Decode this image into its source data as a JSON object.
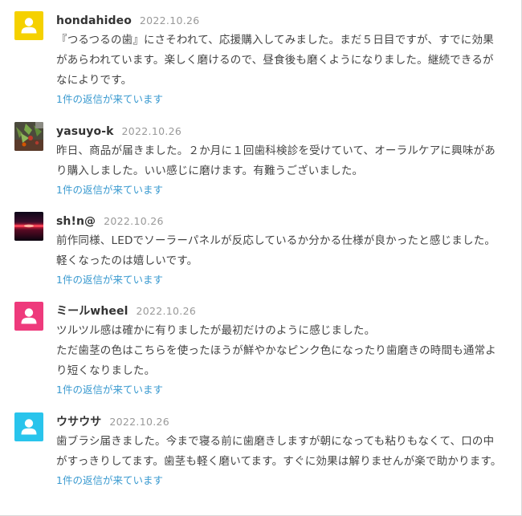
{
  "comments": [
    {
      "author": "hondahideo",
      "date": "2022.10.26",
      "avatar": {
        "kind": "default-user",
        "color": "#f5d100"
      },
      "text": "『つるつるの歯』にさそわれて、応援購入してみました。まだ５日目ですが、すでに効果があらわれています。楽しく磨けるので、昼食後も磨くようになりました。継続できるがなによりです。",
      "replies": "1件の返信が来ています"
    },
    {
      "author": "yasuyo-k",
      "date": "2022.10.26",
      "avatar": {
        "kind": "photo-plants"
      },
      "text": "昨日、商品が届きました。２か月に１回歯科検診を受けていて、オーラルケアに興味があり購入しました。いい感じに磨けます。有難うございました。",
      "replies": "1件の返信が来ています"
    },
    {
      "author": "sh!n@",
      "date": "2022.10.26",
      "avatar": {
        "kind": "photo-sunset"
      },
      "text": "前作同様、LEDでソーラーパネルが反応しているか分かる仕様が良かったと感じました。軽くなったのは嬉しいです。",
      "replies": "1件の返信が来ています"
    },
    {
      "author": "ミールwheel",
      "date": "2022.10.26",
      "avatar": {
        "kind": "default-user",
        "color": "#ee3a7c"
      },
      "text": "ツルツル感は確かに有りましたが最初だけのように感じました。\nただ歯茎の色はこちらを使ったほうが鮮やかなピンク色になったり歯磨きの時間も通常より短くなりました。",
      "replies": "1件の返信が来ています"
    },
    {
      "author": "ウサウサ",
      "date": "2022.10.26",
      "avatar": {
        "kind": "default-user",
        "color": "#29c4ec"
      },
      "text": "歯ブラシ届きました。今まで寝る前に歯磨きしますが朝になっても粘りもなくて、口の中がすっきりしてます。歯茎も軽く磨いてます。すぐに効果は解りませんが楽で助かります。",
      "replies": "1件の返信が来ています"
    }
  ]
}
